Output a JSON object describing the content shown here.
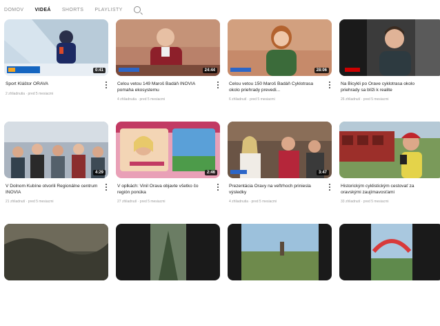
{
  "tabs": [
    {
      "label": "Domov",
      "active": false
    },
    {
      "label": "Videá",
      "active": true
    },
    {
      "label": "Shorts",
      "active": false
    },
    {
      "label": "Playlisty",
      "active": false
    }
  ],
  "videos": [
    {
      "title": "Šport Kláštor ORAVA",
      "stats": "2 zhliadnutia · pred 5 mesiacmi",
      "duration": "0:41"
    },
    {
      "title": "Celou vetou 149 Maroš Badáň INOVIA pomaha ekosystemu",
      "stats": "4 zhliadnutia · pred 5 mesiacmi",
      "duration": "24:44"
    },
    {
      "title": "Celou vetou 150 Maroš Badáň Cyklotrasa okolo priehrady prevedi...",
      "stats": "6 zhliadnutí · pred 5 mesiacmi",
      "duration": "28:06"
    },
    {
      "title": "Na Bicykli po Orave cyklotrasa okolo priehrady sa blíži k realite",
      "stats": "26 zhliadnutí · pred 5 mesiacmi",
      "duration": ""
    },
    {
      "title": "V Dolnom Kubíne otvorili Regionálne centrum INOVIA",
      "stats": "21 zhliadnutí · pred 5 mesiacmi",
      "duration": "4:29"
    },
    {
      "title": "V oplkách: Vinil Orava objavte všetko čo región ponúka",
      "stats": "27 zhliadnutí · pred 5 mesiacmi",
      "duration": "2:46"
    },
    {
      "title": "Prezentácia Oravy na veľtrhoch priniesla výsledky",
      "stats": "4 zhliadnutia · pred 5 mesiacmi",
      "duration": "3:47"
    },
    {
      "title": "Historickým cyklistickým cestovať za oravskými zaujímavosťami",
      "stats": "33 zhliadnutí · pred 5 mesiacmi",
      "duration": ""
    },
    {
      "title": "",
      "stats": "",
      "duration": ""
    },
    {
      "title": "",
      "stats": "",
      "duration": ""
    },
    {
      "title": "",
      "stats": "",
      "duration": ""
    },
    {
      "title": "",
      "stats": "",
      "duration": ""
    }
  ],
  "colors": {
    "accent": "#cc0000",
    "duration_bg": "#000000"
  }
}
